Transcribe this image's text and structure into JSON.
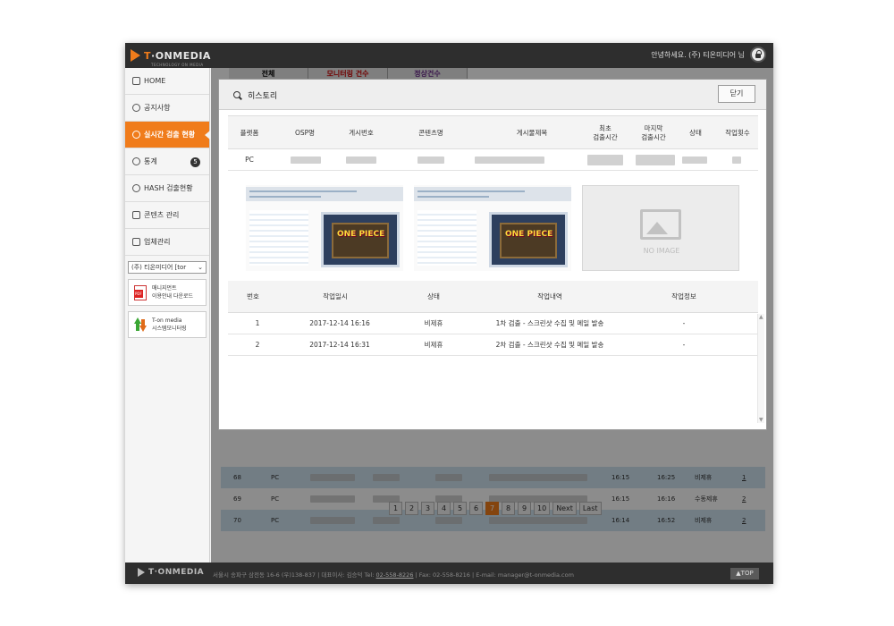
{
  "brand": {
    "prefix": "T",
    "name": "·ONMEDIA",
    "sub": "TECHNOLOGY ON MEDIA"
  },
  "header": {
    "greeting": "안녕하세요. (주) 티온미디어 님"
  },
  "sidebar": {
    "items": [
      {
        "label": "HOME",
        "icon": "home-icon"
      },
      {
        "label": "공지사항",
        "icon": "speech-bubble-icon"
      },
      {
        "label": "실시간 검출 현황",
        "icon": "alert-icon",
        "active": true
      },
      {
        "label": "통계",
        "icon": "pie-chart-icon",
        "badge": "5"
      },
      {
        "label": "HASH 검출현황",
        "icon": "search-icon"
      },
      {
        "label": "콘텐츠 관리",
        "icon": "play-icon"
      },
      {
        "label": "업체관리",
        "icon": "edit-icon"
      }
    ],
    "company_select": "(주) 티온미디어 [tor",
    "manual": {
      "line1": "매니지먼트",
      "line2": "이용안내 다운로드"
    },
    "monitor": {
      "line1": "T-on media",
      "line2": "시스템모니터링"
    }
  },
  "background": {
    "tabs": [
      "전체",
      "모니터링 건수",
      "정상건수"
    ],
    "rows": [
      {
        "no": "68",
        "platform": "PC",
        "first": "16:15",
        "last": "16:25",
        "status": "비제휴",
        "count": "1"
      },
      {
        "no": "69",
        "platform": "PC",
        "first": "16:15",
        "last": "16:16",
        "status": "수동제휴",
        "count": "2"
      },
      {
        "no": "70",
        "platform": "PC",
        "first": "16:14",
        "last": "16:52",
        "status": "비제휴",
        "count": "2"
      }
    ],
    "pagination": [
      "1",
      "2",
      "3",
      "4",
      "5",
      "6",
      "7",
      "8",
      "9",
      "10",
      "Next",
      "Last"
    ],
    "current_page": "7"
  },
  "modal": {
    "title": "히스토리",
    "close_label": "닫기",
    "post_table": {
      "headers": [
        "플랫폼",
        "OSP명",
        "게시번호",
        "콘텐츠명",
        "게시물제목",
        "최초\n검출시간",
        "마지막\n검출시간",
        "상태",
        "작업횟수"
      ],
      "row": {
        "platform": "PC"
      }
    },
    "no_image_label": "NO IMAGE",
    "history_table": {
      "headers": [
        "번호",
        "작업일시",
        "상태",
        "작업내역",
        "작업정보"
      ],
      "rows": [
        {
          "no": "1",
          "datetime": "2017-12-14 16:16",
          "status": "비제휴",
          "detail": "1차 검출 - 스크린샷 수집 및 메일 발송",
          "info": "-"
        },
        {
          "no": "2",
          "datetime": "2017-12-14 16:31",
          "status": "비제휴",
          "detail": "2차 검출 - 스크린샷 수집 및 메일 발송",
          "info": "-"
        }
      ]
    }
  },
  "footer": {
    "address": "서울시 송파구 삼전동 16-6 (우)138-837",
    "ceo": "대표이사: 김승덕",
    "tel_label": "Tel:",
    "tel": "02-558-8226",
    "fax": "Fax: 02-558-8216",
    "email": "E-mail: manager@t-onmedia.com",
    "top_label": "▲TOP"
  }
}
